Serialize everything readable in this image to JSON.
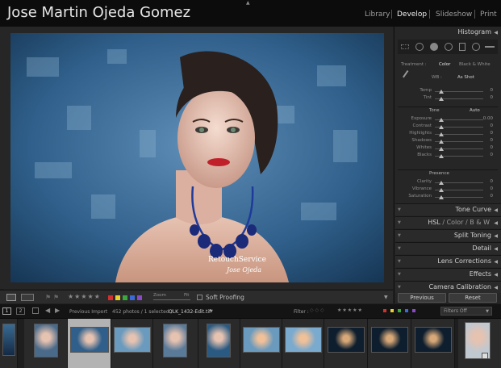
{
  "identity_plate": "Jose Martin Ojeda Gomez",
  "modules": [
    "Library",
    "Develop",
    "Slideshow",
    "Print"
  ],
  "active_module": "Develop",
  "panels": {
    "histogram": "Histogram",
    "basic_tabs": [
      "Treatment :",
      "Color",
      "Black & White"
    ],
    "wb_label": "WB :",
    "wb_value": "As Shot",
    "wb_sliders": [
      {
        "label": "Temp",
        "value": "0"
      },
      {
        "label": "Tint",
        "value": "0"
      }
    ],
    "tone_label": "Tone",
    "tone_auto": "Auto",
    "tone_sliders": [
      {
        "label": "Exposure",
        "value": "0.00"
      },
      {
        "label": "Contrast",
        "value": "0"
      },
      {
        "label": "Highlights",
        "value": "0"
      },
      {
        "label": "Shadows",
        "value": "0"
      },
      {
        "label": "Whites",
        "value": "0"
      },
      {
        "label": "Blacks",
        "value": "0"
      }
    ],
    "presence_label": "Presence",
    "presence_sliders": [
      {
        "label": "Clarity",
        "value": "0"
      },
      {
        "label": "Vibrance",
        "value": "0"
      },
      {
        "label": "Saturation",
        "value": "0"
      }
    ],
    "collapsed": [
      "Tone Curve",
      "HSL / Color / B & W",
      "Split Toning",
      "Detail",
      "Lens Corrections",
      "Effects",
      "Camera Calibration"
    ],
    "hsl_parts": [
      "HSL",
      "/",
      "Color",
      "/",
      "B & W"
    ]
  },
  "buttons": {
    "previous": "Previous",
    "reset": "Reset"
  },
  "toolbar": {
    "zoom_label": "Zoom",
    "zoom_value": "Fit",
    "soft_proofing": "Soft Proofing",
    "label_colors": [
      "#d0302e",
      "#e8d02e",
      "#3aa83a",
      "#3a6ad8",
      "#8a4ac8"
    ]
  },
  "filmstrip_bar": {
    "page_buttons": [
      "1",
      "2"
    ],
    "source": "Previous Import",
    "count": "452 photos / 1 selected /",
    "filename": "OLK_1432-Edit.tif",
    "filter_label": "Filter :",
    "filters_off": "Filters Off"
  },
  "watermark": "RetouchService",
  "watermark_sig": "Jose Ojeda"
}
